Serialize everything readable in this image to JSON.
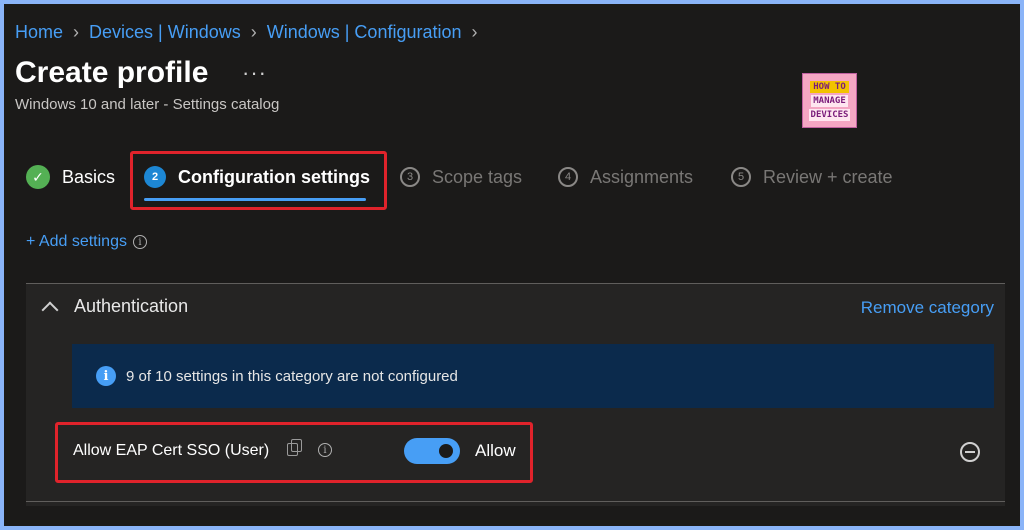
{
  "breadcrumb": [
    {
      "label": "Home"
    },
    {
      "label": "Devices | Windows"
    },
    {
      "label": "Windows | Configuration"
    }
  ],
  "header": {
    "title": "Create profile",
    "more": "···",
    "subtitle": "Windows 10 and later - Settings catalog"
  },
  "logo": {
    "line1": "HOW TO",
    "line2": "MANAGE",
    "line3": "DEVICES"
  },
  "wizard": {
    "steps": [
      {
        "number": "✓",
        "label": "Basics",
        "state": "done"
      },
      {
        "number": "2",
        "label": "Configuration settings",
        "state": "active"
      },
      {
        "number": "3",
        "label": "Scope tags",
        "state": "pending"
      },
      {
        "number": "4",
        "label": "Assignments",
        "state": "pending"
      },
      {
        "number": "5",
        "label": "Review + create",
        "state": "pending"
      }
    ]
  },
  "add_settings": {
    "label": "+ Add settings",
    "info": "i"
  },
  "category": {
    "title": "Authentication",
    "remove_label": "Remove category",
    "info_text": "9 of 10 settings in this category are not configured",
    "info_icon": "i",
    "setting": {
      "name": "Allow EAP Cert SSO (User)",
      "info": "i",
      "toggle_on": true,
      "toggle_label": "Allow"
    }
  },
  "colors": {
    "accent": "#479ef5",
    "highlight": "#e0232b",
    "success": "#54b054",
    "background": "#1b1a19"
  }
}
